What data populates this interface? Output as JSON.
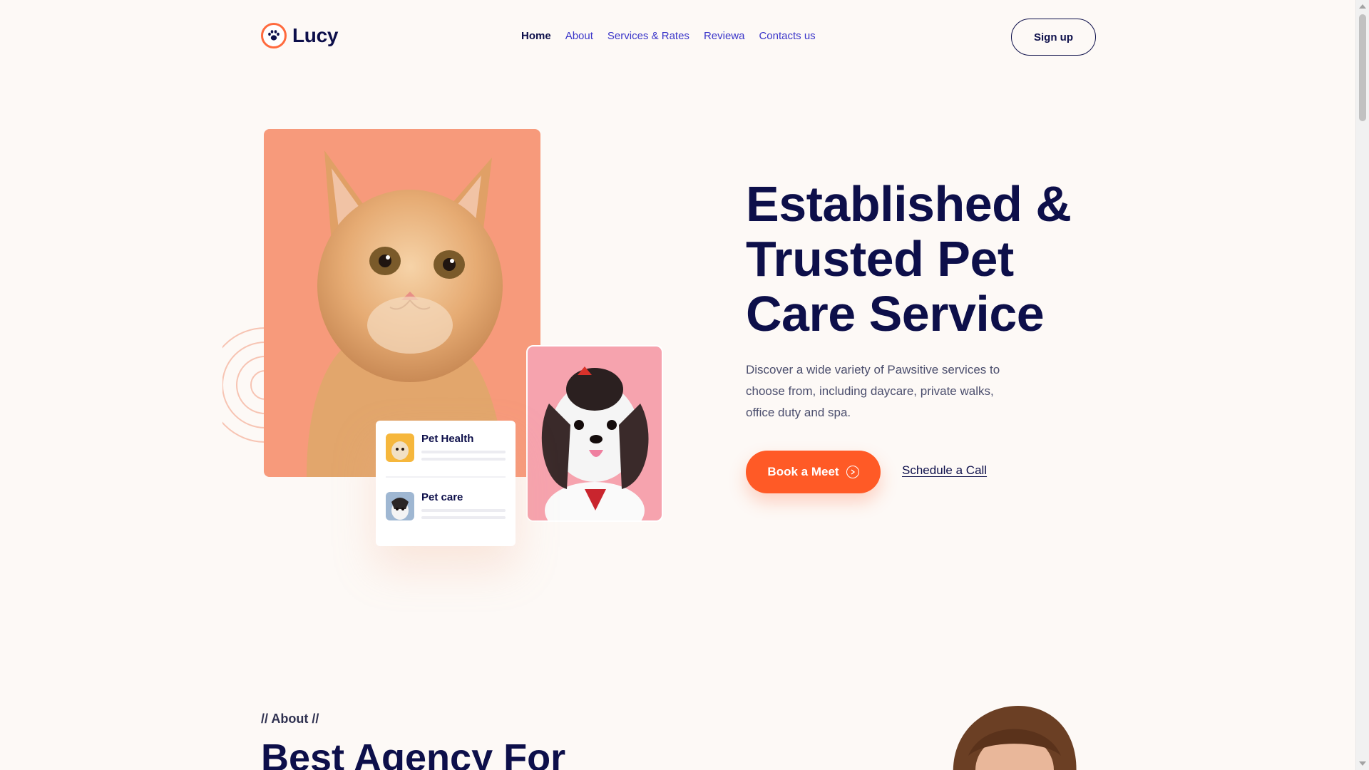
{
  "header": {
    "logo_text": "Lucy",
    "logo_icon": "paw-icon",
    "nav": [
      {
        "label": "Home",
        "active": true
      },
      {
        "label": "About"
      },
      {
        "label": "Services & Rates"
      },
      {
        "label": "Reviewa"
      },
      {
        "label": "Contacts us"
      }
    ],
    "signup_label": "Sign up"
  },
  "hero": {
    "title_lines": [
      "Established &",
      "Trusted Pet",
      "Care Service"
    ],
    "description": "Discover a wide variety of Pawsitive services to choose from, including daycare, private walks, office duty and spa.",
    "primary_cta": "Book a Meet",
    "secondary_cta": "Schedule a Call",
    "services": [
      {
        "title": "Pet Health",
        "icon": "dog-thumbnail"
      },
      {
        "title": "Pet care",
        "icon": "puppy-thumbnail"
      }
    ]
  },
  "about": {
    "eyebrow": "// About //",
    "title": "Best Agency For"
  },
  "colors": {
    "background": "#fdf9f6",
    "navy": "#0d0f4a",
    "link": "#3a35c9",
    "accent": "#ff5a26",
    "cat_card": "#f79a7b",
    "dog_card": "#f6a3ae"
  }
}
